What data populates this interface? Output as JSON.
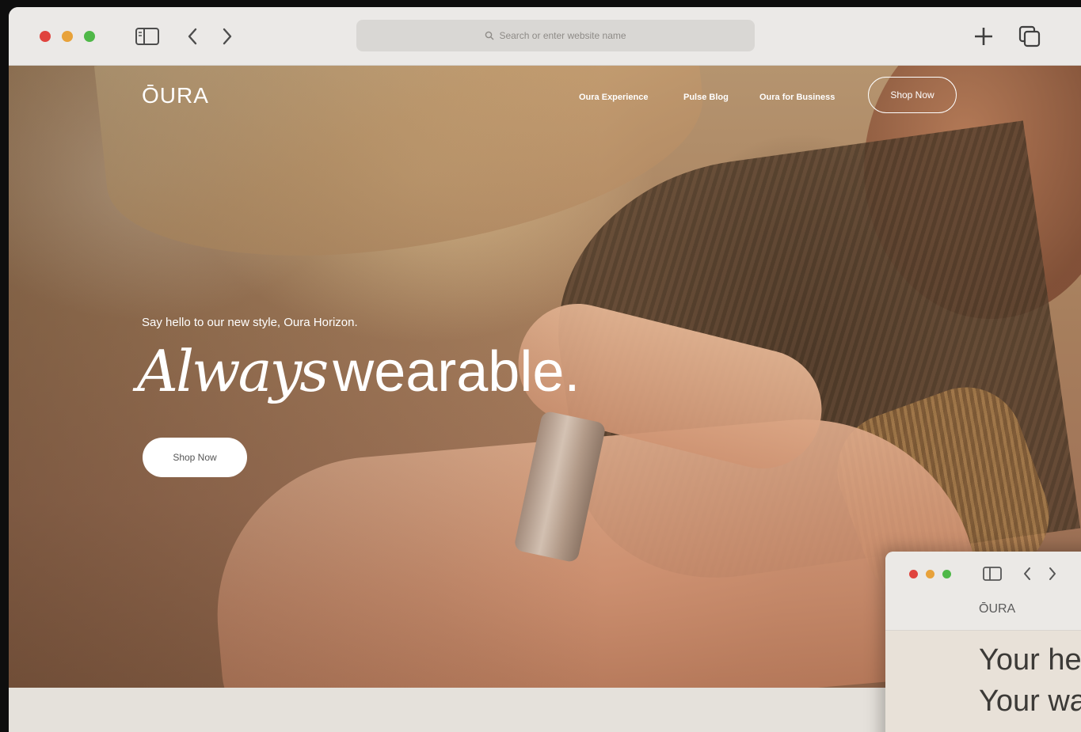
{
  "browser": {
    "address_placeholder": "Search or enter website name"
  },
  "site": {
    "brand": "ŌURA",
    "nav": [
      {
        "label": "Oura Experience"
      },
      {
        "label": "Pulse Blog"
      },
      {
        "label": "Oura for Business"
      }
    ],
    "nav_shop_label": "Shop Now"
  },
  "hero": {
    "kicker": "Say hello to our new style, Oura Horizon.",
    "headline_italic": "Always",
    "headline_rest": "wearable.",
    "cta_label": "Shop Now"
  },
  "mini_window": {
    "brand": "ŌURA",
    "line_1": "Your he",
    "line_2": "Your wa"
  },
  "colors": {
    "traffic_red": "#e0443e",
    "traffic_yellow": "#e8a23a",
    "traffic_green": "#4fb848",
    "toolbar_bg": "#ebe9e7",
    "page_bg": "#e5e1db"
  },
  "icons": [
    "sidebar-icon",
    "chevron-left-icon",
    "chevron-right-icon",
    "search-icon",
    "plus-icon",
    "tabs-icon"
  ]
}
